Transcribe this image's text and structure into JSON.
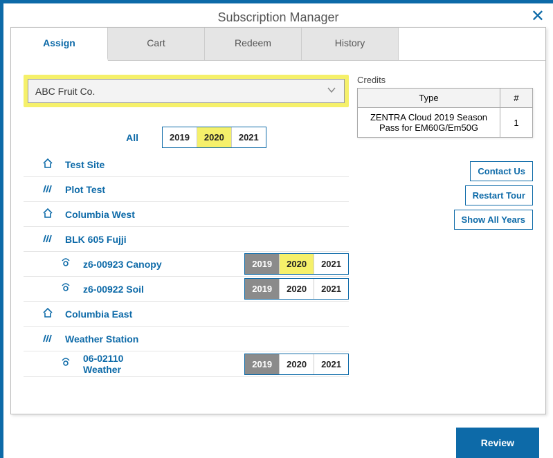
{
  "title": "Subscription Manager",
  "tabs": {
    "assign": "Assign",
    "cart": "Cart",
    "redeem": "Redeem",
    "history": "History"
  },
  "org": {
    "selected": "ABC Fruit Co."
  },
  "all_label": "All",
  "years": {
    "y2019": "2019",
    "y2020": "2020",
    "y2021": "2021"
  },
  "tree": {
    "test_site": "Test Site",
    "plot_test": "Plot Test",
    "columbia_west": "Columbia West",
    "blk_605": "BLK 605 Fujji",
    "z6_canopy": "z6-00923 Canopy",
    "z6_soil": "z6-00922 Soil",
    "columbia_east": "Columbia East",
    "weather_station": "Weather Station",
    "weather_device": "06-02110 Weather"
  },
  "credits": {
    "header": "Credits",
    "col_type": "Type",
    "col_count": "#",
    "row1_type": "ZENTRA Cloud 2019 Season Pass for EM60G/Em50G",
    "row1_count": "1"
  },
  "side": {
    "contact": "Contact Us",
    "restart": "Restart Tour",
    "show_all": "Show All Years"
  },
  "review": "Review"
}
